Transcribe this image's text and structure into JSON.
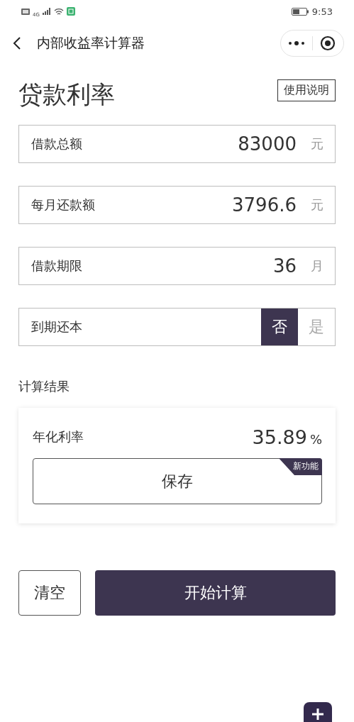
{
  "status_bar": {
    "network": "4G",
    "time": "9:53"
  },
  "nav": {
    "title": "内部收益率计算器"
  },
  "header": {
    "title": "贷款利率",
    "help_button": "使用说明"
  },
  "fields": [
    {
      "kind": "input",
      "label": "借款总额",
      "value": "83000",
      "unit": "元"
    },
    {
      "kind": "input",
      "label": "每月还款额",
      "value": "3796.6",
      "unit": "元"
    },
    {
      "kind": "input",
      "label": "借款期限",
      "value": "36",
      "unit": "月"
    },
    {
      "kind": "toggle",
      "label": "到期还本",
      "options": [
        {
          "label": "否",
          "selected": true
        },
        {
          "label": "是",
          "selected": false
        }
      ]
    }
  ],
  "result": {
    "section_title": "计算结果",
    "label": "年化利率",
    "value": "35.89",
    "unit": "%",
    "save_button": "保存",
    "badge": "新功能"
  },
  "actions": {
    "clear_button": "清空",
    "calculate_button": "开始计算"
  }
}
